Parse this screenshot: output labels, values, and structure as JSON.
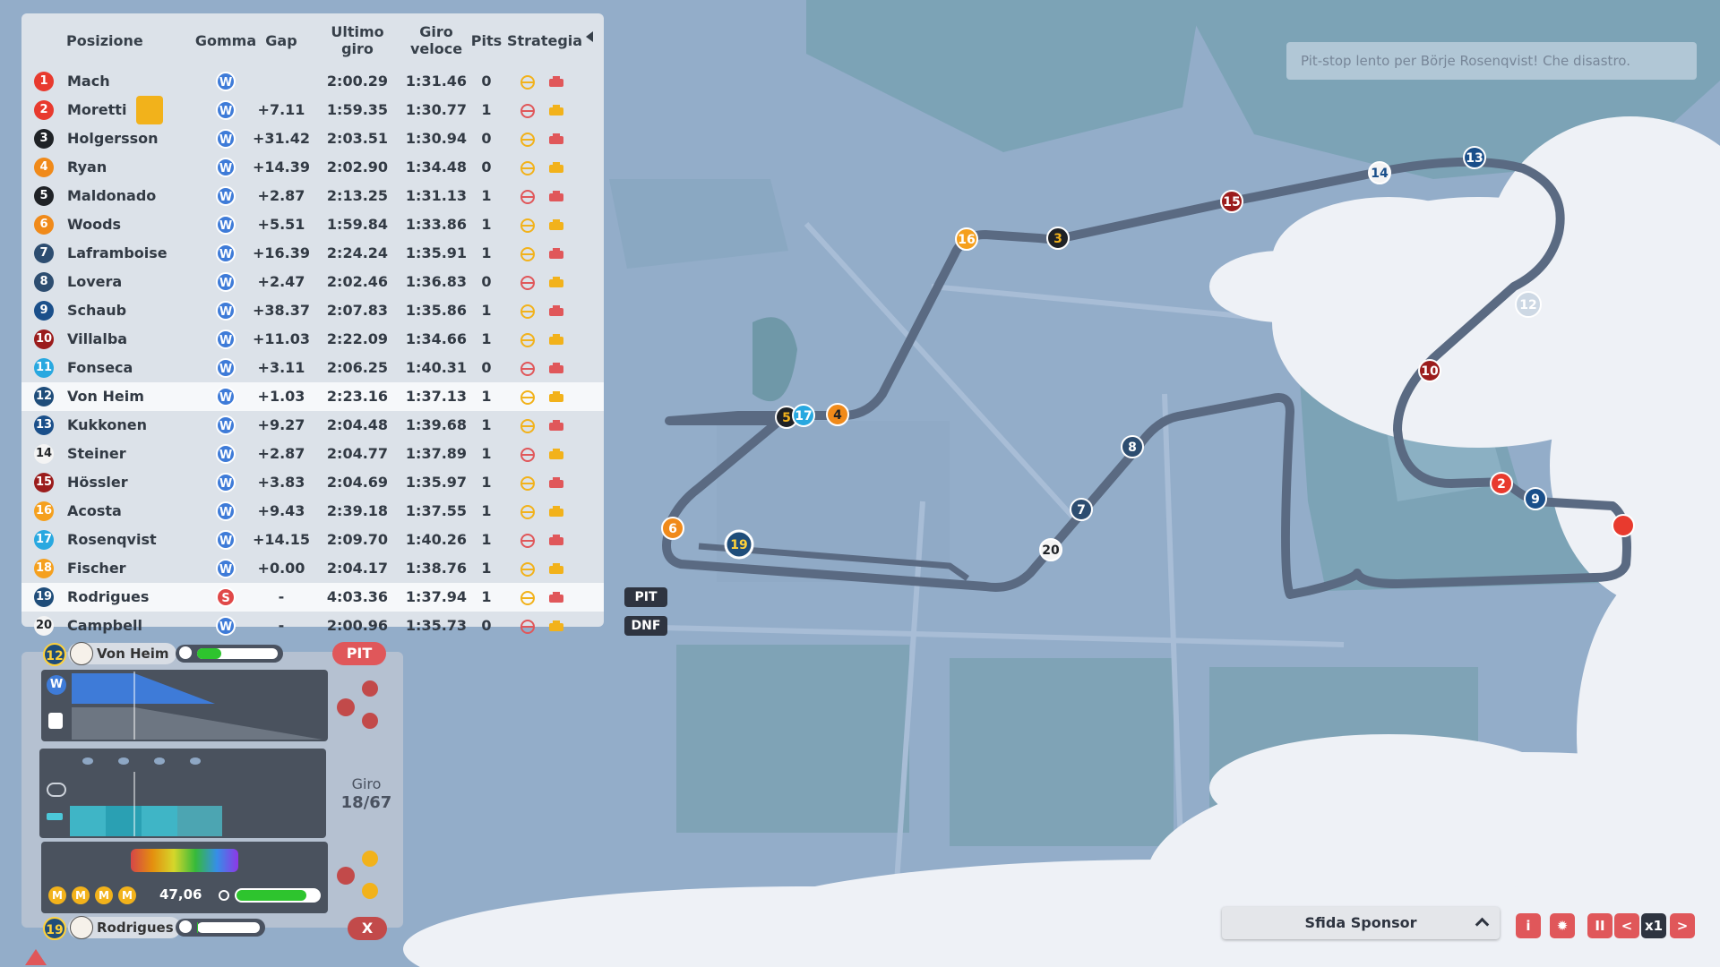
{
  "standings": {
    "headers": {
      "pos": "Posizione",
      "tyre": "Gomma",
      "gap": "Gap",
      "last": "Ultimo giro",
      "fast": "Giro veloce",
      "pits": "Pits",
      "strat": "Strategia"
    },
    "rows": [
      {
        "n": "1",
        "name": "Mach",
        "tyre": "W",
        "gap": "",
        "last": "2:00.29",
        "fast": "1:31.46",
        "pits": "0",
        "color": "#e83a2e"
      },
      {
        "n": "2",
        "name": "Moretti",
        "tyre": "W",
        "gap": "+7.11",
        "last": "1:59.35",
        "fast": "1:30.77",
        "pits": "1",
        "color": "#e83a2e"
      },
      {
        "n": "3",
        "name": "Holgersson",
        "tyre": "W",
        "gap": "+31.42",
        "last": "2:03.51",
        "fast": "1:30.94",
        "pits": "0",
        "color": "#1f2226"
      },
      {
        "n": "4",
        "name": "Ryan",
        "tyre": "W",
        "gap": "+14.39",
        "last": "2:02.90",
        "fast": "1:34.48",
        "pits": "0",
        "color": "#f08a1a"
      },
      {
        "n": "5",
        "name": "Maldonado",
        "tyre": "W",
        "gap": "+2.87",
        "last": "2:13.25",
        "fast": "1:31.13",
        "pits": "1",
        "color": "#1f2226"
      },
      {
        "n": "6",
        "name": "Woods",
        "tyre": "W",
        "gap": "+5.51",
        "last": "1:59.84",
        "fast": "1:33.86",
        "pits": "1",
        "color": "#f08a1a"
      },
      {
        "n": "7",
        "name": "Laframboise",
        "tyre": "W",
        "gap": "+16.39",
        "last": "2:24.24",
        "fast": "1:35.91",
        "pits": "1",
        "color": "#2d4d70"
      },
      {
        "n": "8",
        "name": "Lovera",
        "tyre": "W",
        "gap": "+2.47",
        "last": "2:02.46",
        "fast": "1:36.83",
        "pits": "0",
        "color": "#2d4d70"
      },
      {
        "n": "9",
        "name": "Schaub",
        "tyre": "W",
        "gap": "+38.37",
        "last": "2:07.83",
        "fast": "1:35.86",
        "pits": "1",
        "color": "#1a4f8a"
      },
      {
        "n": "10",
        "name": "Villalba",
        "tyre": "W",
        "gap": "+11.03",
        "last": "2:22.09",
        "fast": "1:34.66",
        "pits": "1",
        "color": "#9b1c1c"
      },
      {
        "n": "11",
        "name": "Fonseca",
        "tyre": "W",
        "gap": "+3.11",
        "last": "2:06.25",
        "fast": "1:40.31",
        "pits": "0",
        "color": "#28a8e0"
      },
      {
        "n": "12",
        "name": "Von Heim",
        "tyre": "W",
        "gap": "+1.03",
        "last": "2:23.16",
        "fast": "1:37.13",
        "pits": "1",
        "color": "#1f4d7a"
      },
      {
        "n": "13",
        "name": "Kukkonen",
        "tyre": "W",
        "gap": "+9.27",
        "last": "2:04.48",
        "fast": "1:39.68",
        "pits": "1",
        "color": "#1a4f8a"
      },
      {
        "n": "14",
        "name": "Steiner",
        "tyre": "W",
        "gap": "+2.87",
        "last": "2:04.77",
        "fast": "1:37.89",
        "pits": "1",
        "color": "#f4f4f4"
      },
      {
        "n": "15",
        "name": "Hössler",
        "tyre": "W",
        "gap": "+3.83",
        "last": "2:04.69",
        "fast": "1:35.97",
        "pits": "1",
        "color": "#9b1c1c"
      },
      {
        "n": "16",
        "name": "Acosta",
        "tyre": "W",
        "gap": "+9.43",
        "last": "2:39.18",
        "fast": "1:37.55",
        "pits": "1",
        "color": "#f5a01e"
      },
      {
        "n": "17",
        "name": "Rosenqvist",
        "tyre": "W",
        "gap": "+14.15",
        "last": "2:09.70",
        "fast": "1:40.26",
        "pits": "1",
        "color": "#28a8e0"
      },
      {
        "n": "18",
        "name": "Fischer",
        "tyre": "W",
        "gap": "+0.00",
        "last": "2:04.17",
        "fast": "1:38.76",
        "pits": "1",
        "color": "#f5a01e"
      },
      {
        "n": "19",
        "name": "Rodrigues",
        "tyre": "S",
        "gap": "-",
        "last": "4:03.36",
        "fast": "1:37.94",
        "pits": "1",
        "color": "#1f4d7a",
        "tag": "PIT"
      },
      {
        "n": "20",
        "name": "Campbell",
        "tyre": "W",
        "gap": "-",
        "last": "2:00.96",
        "fast": "1:35.73",
        "pits": "0",
        "color": "#f4f4f4",
        "tag": "DNF"
      }
    ]
  },
  "driver_panel": {
    "driver1": {
      "number": "12",
      "name": "Von Heim",
      "pit_label": "PIT",
      "energy": 0.3
    },
    "lap_label": "Giro",
    "lap_value": "18/67",
    "tyre_value": "W",
    "stat_value": "47,06",
    "car_health": 0.85,
    "compound_labels": [
      "M",
      "M",
      "M",
      "M"
    ],
    "driver2": {
      "number": "19",
      "name": "Rodrigues",
      "close_label": "X",
      "energy": 0.02
    }
  },
  "notice": "Pit-stop lento per Börje Rosenqvist! Che disastro.",
  "sponsor": "Sfida Sponsor",
  "controls": {
    "speed": "x1",
    "prev": "<",
    "next": ">",
    "pause": "II"
  },
  "colors": {
    "accent": "#e0575a",
    "track": "#5a6a82",
    "water": "#7fa3b5"
  }
}
